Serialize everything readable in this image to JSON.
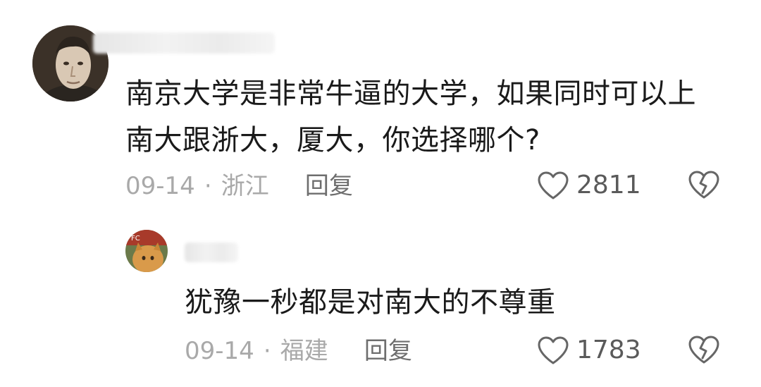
{
  "comment": {
    "text": "南京大学是非常牛逼的大学，如果同时可以上南大跟浙大，厦大，你选择哪个?",
    "date": "09-14",
    "separator": "·",
    "location": "浙江",
    "reply_label": "回复",
    "likes": "2811"
  },
  "reply": {
    "avatar_badge": "FC",
    "text": "犹豫一秒都是对南大的不尊重",
    "date": "09-14",
    "separator": "·",
    "location": "福建",
    "reply_label": "回复",
    "likes": "1783"
  },
  "icons": {
    "like": "heart-outline-icon",
    "dislike": "broken-heart-icon"
  }
}
